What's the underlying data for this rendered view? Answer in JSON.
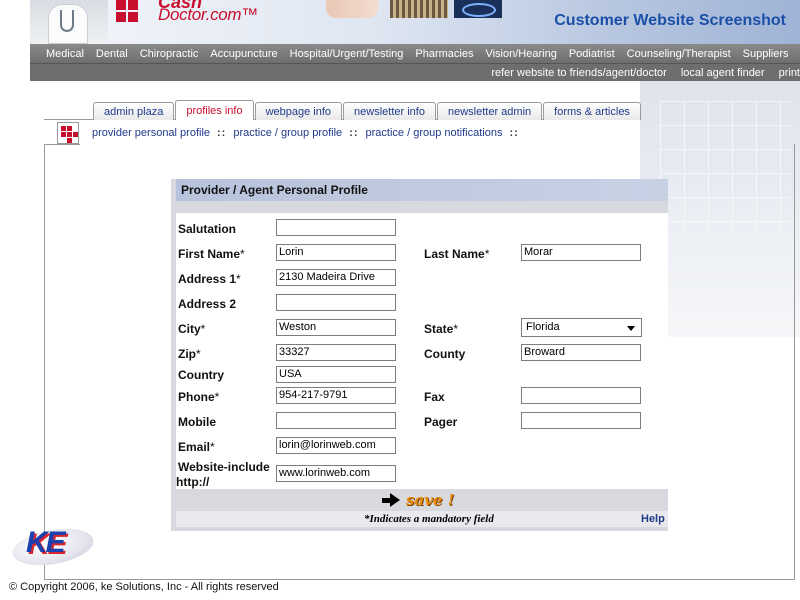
{
  "header": {
    "brand_top": "Cash",
    "brand": "Doctor.com™",
    "title": "Customer Website Screenshot"
  },
  "main_nav": [
    "Medical",
    "Dental",
    "Chiropractic",
    "Accupuncture",
    "Hospital/Urgent/Testing",
    "Pharmacies",
    "Vision/Hearing",
    "Podiatrist",
    "Counseling/Therapist",
    "Suppliers"
  ],
  "sub_nav": [
    "refer website to friends/agent/doctor",
    "local agent finder",
    "print"
  ],
  "tabs": [
    {
      "label": "admin plaza",
      "active": false
    },
    {
      "label": "profiles info",
      "active": true
    },
    {
      "label": "webpage info",
      "active": false
    },
    {
      "label": "newsletter info",
      "active": false
    },
    {
      "label": "newsletter admin",
      "active": false
    },
    {
      "label": "forms & articles",
      "active": false
    }
  ],
  "subtabs": [
    "provider personal profile",
    "practice / group profile",
    "practice / group notifications"
  ],
  "subtab_sep": "::",
  "form": {
    "title": "Provider / Agent Personal Profile",
    "labels": {
      "salutation": "Salutation",
      "first_name": "First Name",
      "last_name": "Last Name",
      "address1": "Address 1",
      "address2": "Address 2",
      "city": "City",
      "state": "State",
      "zip": "Zip",
      "county": "County",
      "country": "Country",
      "phone": "Phone",
      "fax": "Fax",
      "mobile": "Mobile",
      "pager": "Pager",
      "email": "Email",
      "website_line1": "Website-include",
      "website_line2": "http://"
    },
    "required_mark": "*",
    "values": {
      "salutation": "",
      "first_name": "Lorin",
      "last_name": "Morar",
      "address1": "2130 Madeira Drive",
      "address2": "",
      "city": "Weston",
      "state": "Florida",
      "zip": "33327",
      "county": "Broward",
      "country": "USA",
      "phone": "954-217-9791",
      "fax": "",
      "mobile": "",
      "pager": "",
      "email": "lorin@lorinweb.com",
      "website": "www.lorinweb.com"
    },
    "save_label": "save !",
    "mandatory_note": "*Indicates a mandatory field",
    "help_label": "Help"
  },
  "footer": {
    "ke_logo": "KE",
    "copyright": "© Copyright 2006, ke Solutions, Inc - All rights reserved"
  },
  "colors": {
    "brand_red": "#c8102e",
    "link_blue": "#1f3a8a",
    "title_blue": "#1b4fa8",
    "nav_gray": "#7a7a7a"
  }
}
